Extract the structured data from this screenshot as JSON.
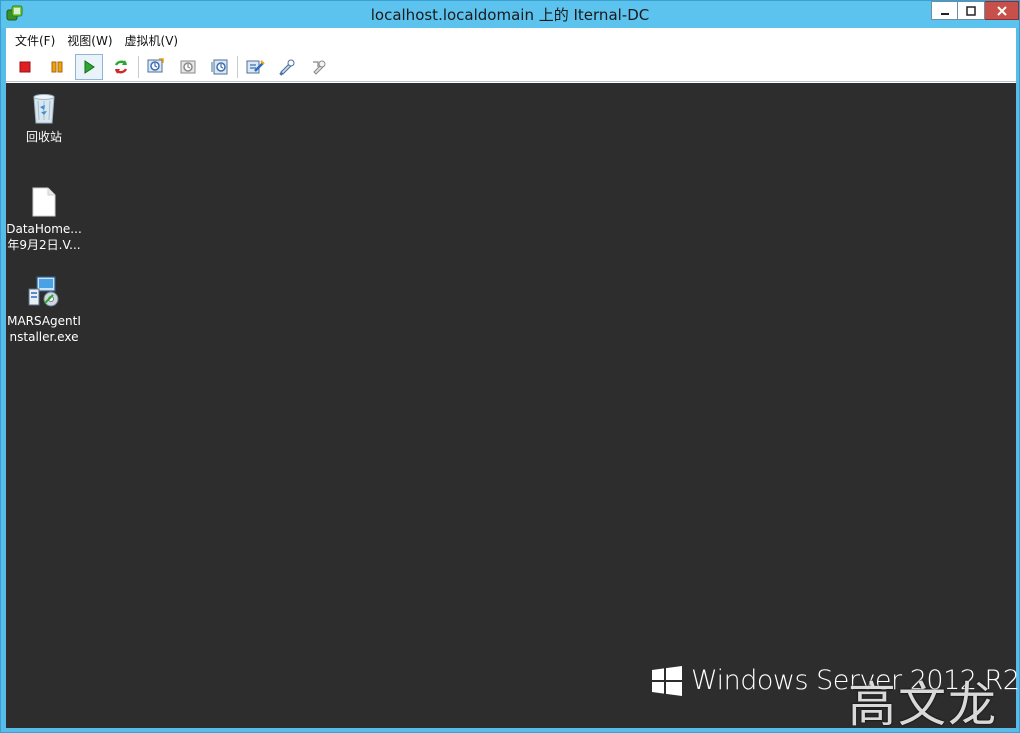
{
  "window": {
    "title": "localhost.localdomain 上的 Iternal-DC",
    "controls": [
      "minimize-icon",
      "maximize-icon",
      "close-icon"
    ]
  },
  "menubar": {
    "items": [
      {
        "label": "文件(F)"
      },
      {
        "label": "视图(W)"
      },
      {
        "label": "虚拟机(V)"
      }
    ]
  },
  "toolbar": {
    "buttons": [
      {
        "icon": "stop-icon",
        "color": "#e02020"
      },
      {
        "icon": "pause-icon",
        "color": "#f0a010"
      },
      {
        "icon": "play-icon",
        "color": "#2aa830"
      },
      {
        "icon": "refresh-icon",
        "color": "#d02a2a"
      },
      {
        "icon": "snapshot-icon"
      },
      {
        "icon": "revert-snapshot-icon"
      },
      {
        "icon": "manage-snapshots-icon"
      },
      {
        "icon": "send-ctrl-alt-del-icon"
      },
      {
        "icon": "edit-settings-icon"
      },
      {
        "icon": "vm-settings-icon"
      }
    ]
  },
  "desktop": {
    "background": "#2d2d2d",
    "icons": [
      {
        "icon": "recycle-bin-icon",
        "label_lines": [
          "回收站"
        ]
      },
      {
        "icon": "file-icon",
        "label_lines": [
          "DataHome...",
          "年9月2日.V..."
        ]
      },
      {
        "icon": "installer-icon",
        "label_lines": [
          "MARSAgentI",
          "nstaller.exe"
        ]
      }
    ],
    "branding": "Windows Server 2012 R2",
    "watermark": "高文龙"
  }
}
